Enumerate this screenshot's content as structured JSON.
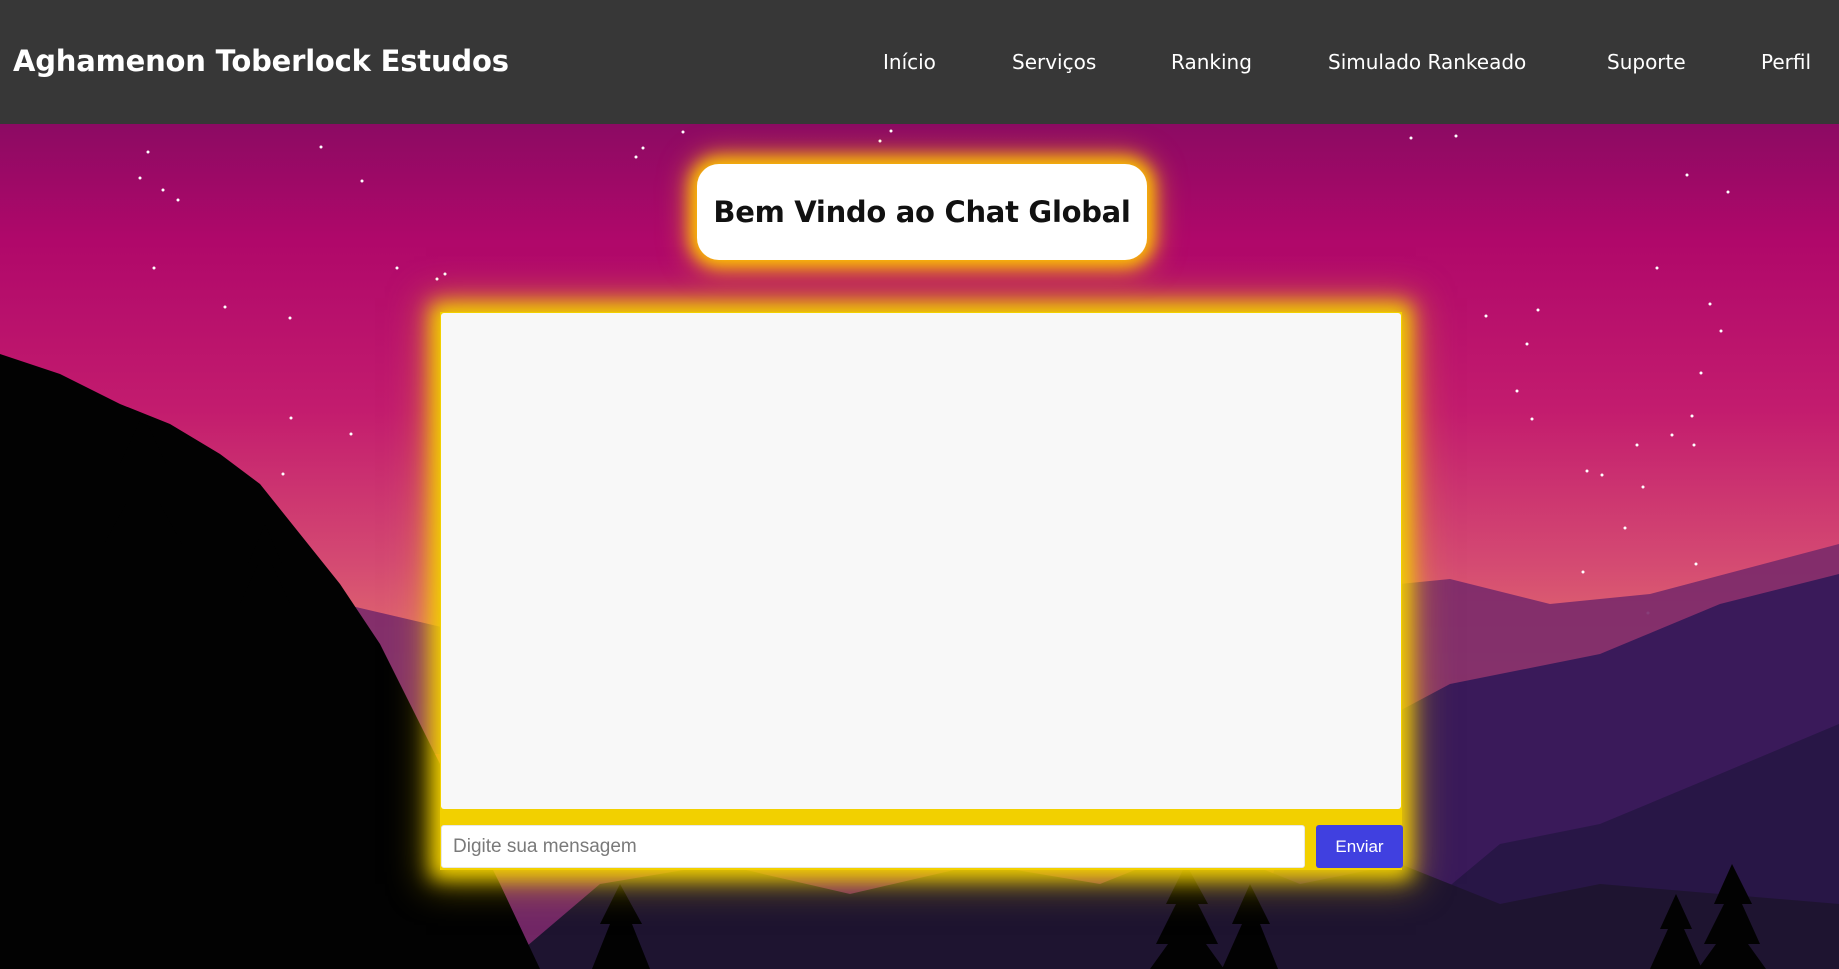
{
  "header": {
    "brand": "Aghamenon Toberlock Estudos",
    "nav": [
      {
        "id": "inicio",
        "label": "Início"
      },
      {
        "id": "servicos",
        "label": "Serviços"
      },
      {
        "id": "ranking",
        "label": "Ranking"
      },
      {
        "id": "simulado",
        "label": "Simulado Rankeado"
      },
      {
        "id": "suporte",
        "label": "Suporte"
      },
      {
        "id": "perfil",
        "label": "Perfil"
      }
    ]
  },
  "welcome": {
    "title": "Bem Vindo ao Chat Global"
  },
  "chat": {
    "input_value": "",
    "input_placeholder": "Digite sua mensagem",
    "send_label": "Enviar"
  },
  "colors": {
    "header_bg": "#373737",
    "glow": "#f2d000",
    "send_button": "#4040e0",
    "sky_top": "#8c0a63",
    "sky_horizon": "#f1855c"
  }
}
